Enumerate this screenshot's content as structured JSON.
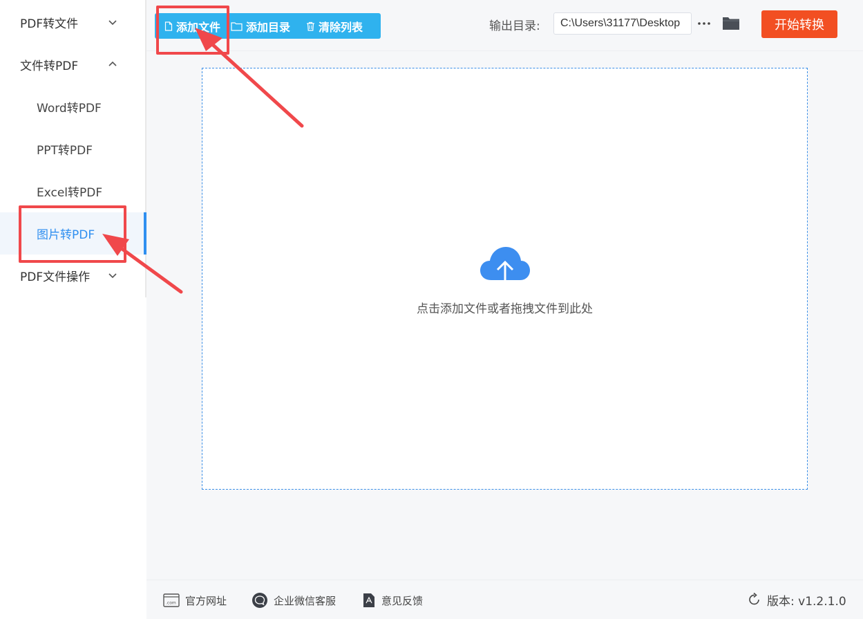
{
  "sidebar": {
    "groups": [
      {
        "label": "PDF转文件",
        "expanded": false
      },
      {
        "label": "文件转PDF",
        "expanded": true
      },
      {
        "label": "PDF文件操作",
        "expanded": false
      }
    ],
    "items": [
      {
        "label": "Word转PDF"
      },
      {
        "label": "PPT转PDF"
      },
      {
        "label": "Excel转PDF"
      },
      {
        "label": "图片转PDF",
        "active": true
      }
    ]
  },
  "toolbar": {
    "add_file_label": "添加文件",
    "add_dir_label": "添加目录",
    "clear_label": "清除列表",
    "button_color": "#2fb2ee"
  },
  "output": {
    "label": "输出目录:",
    "path": "C:\\Users\\31177\\Desktop",
    "more_icon": "ellipsis-icon",
    "folder_icon": "folder-icon"
  },
  "start_button": {
    "label": "开始转换",
    "color": "#f24f22"
  },
  "drop_zone": {
    "text": "点击添加文件或者拖拽文件到此处",
    "icon": "cloud-upload-icon",
    "accent": "#3a8ee6"
  },
  "footer": {
    "links": [
      {
        "label": "官方网址",
        "icon": "website-icon"
      },
      {
        "label": "企业微信客服",
        "icon": "chat-icon"
      },
      {
        "label": "意见反馈",
        "icon": "feedback-icon"
      }
    ],
    "version": "版本: v1.2.1.0"
  },
  "annotation_color": "#f0484b"
}
